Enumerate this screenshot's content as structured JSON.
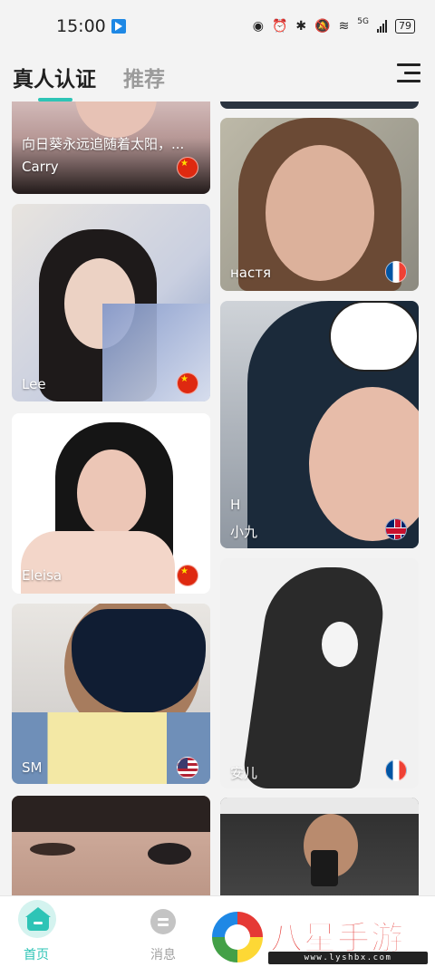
{
  "status_bar": {
    "time": "15:00",
    "network": "5G",
    "battery": "79"
  },
  "header": {
    "tabs": [
      {
        "label": "真人认证",
        "active": true
      },
      {
        "label": "推荐",
        "active": false
      }
    ],
    "accent_color": "#2ec4b6"
  },
  "feed": {
    "cards": [
      {
        "name": "Carry",
        "caption": "向日葵永远追随着太阳，...",
        "flag": "China"
      },
      {
        "name": "Lee",
        "flag": "China"
      },
      {
        "name": "Eleisa",
        "flag": "China"
      },
      {
        "name": "SM",
        "flag": "USA"
      },
      {
        "name": "настя",
        "flag": "France"
      },
      {
        "sub": "H",
        "name": "小九",
        "flag": "UK"
      },
      {
        "name": "安儿",
        "flag": "France"
      }
    ]
  },
  "bottom_nav": {
    "items": [
      {
        "label": "首页",
        "icon": "home-icon",
        "active": true
      },
      {
        "label": "消息",
        "icon": "message-icon",
        "active": false
      }
    ]
  },
  "watermark": {
    "title": "八星手游网",
    "url": "www.lyshbx.com"
  }
}
